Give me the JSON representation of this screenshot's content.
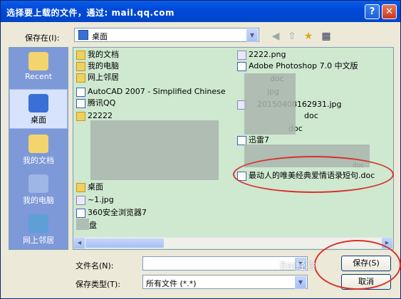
{
  "window": {
    "title": "选择要上载的文件，通过: mail.qq.com",
    "help_label": "?",
    "close_label": "✕"
  },
  "lookin": {
    "label": "保存在(I):",
    "value": "桌面"
  },
  "places": [
    {
      "label": "Recent",
      "icon": "recent-icon"
    },
    {
      "label": "桌面",
      "icon": "desktop-icon"
    },
    {
      "label": "我的文档",
      "icon": "my-documents-icon"
    },
    {
      "label": "我的电脑",
      "icon": "my-computer-icon"
    },
    {
      "label": "网上邻居",
      "icon": "network-icon"
    }
  ],
  "files_left": [
    {
      "name": "我的文档",
      "type": "folder"
    },
    {
      "name": "我的电脑",
      "type": "folder"
    },
    {
      "name": "网上邻居",
      "type": "folder"
    },
    {
      "name": "AutoCAD 2007 - Simplified Chinese",
      "type": "doc"
    },
    {
      "name": "腾讯QQ",
      "type": "doc"
    },
    {
      "name": "22222",
      "type": "folder"
    },
    {
      "name": "桌面",
      "type": "folder"
    },
    {
      "name": "~1.jpg",
      "type": "img"
    },
    {
      "name": "360安全浏览器7",
      "type": "doc"
    },
    {
      "name": "盘",
      "type": "doc"
    }
  ],
  "files_right": [
    {
      "name": "2222.png",
      "type": "img"
    },
    {
      "name": "Adobe Photoshop 7.0 中文版",
      "type": "doc"
    },
    {
      "name": "doc",
      "type": "doc"
    },
    {
      "name": "jpg",
      "type": "img"
    },
    {
      "name": "20150408162931.jpg",
      "type": "img"
    },
    {
      "name": "doc",
      "type": "doc"
    },
    {
      "name": "doc",
      "type": "doc"
    },
    {
      "name": "迅雷7",
      "type": "doc"
    },
    {
      "name": "doc",
      "type": "doc"
    },
    {
      "name": "最动人的唯美经典爱情语录短句.doc",
      "type": "doc"
    }
  ],
  "filename": {
    "label": "文件名(N):",
    "value": ""
  },
  "filetype": {
    "label": "保存类型(T):",
    "value": "所有文件 (*.*)"
  },
  "buttons": {
    "save": "保存(S)",
    "cancel": "取消"
  },
  "watermark": "Bai经验"
}
